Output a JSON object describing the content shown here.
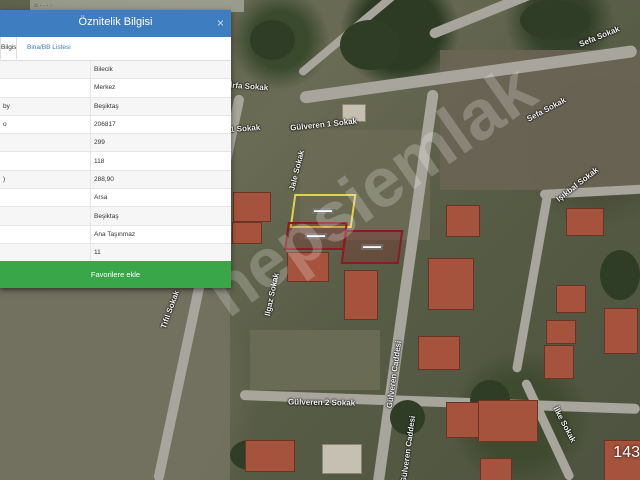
{
  "panel": {
    "title": "Öznitelik Bilgisi",
    "close_glyph": "×",
    "tabs": [
      {
        "label": "Bilgisi",
        "active": true
      },
      {
        "label": "Bina/BB Listesi",
        "active": false
      }
    ],
    "rows": [
      {
        "key": "",
        "value": "Bilecik"
      },
      {
        "key": "",
        "value": "Merkez"
      },
      {
        "key": "by",
        "value": "Beşiktaş"
      },
      {
        "key": "o",
        "value": "206817"
      },
      {
        "key": "",
        "value": "299"
      },
      {
        "key": "",
        "value": "118"
      },
      {
        "key": ")",
        "value": "288,90"
      },
      {
        "key": "",
        "value": "Arsa"
      },
      {
        "key": "",
        "value": "Beşiktaş"
      },
      {
        "key": "",
        "value": "Ana Taşınmaz"
      },
      {
        "key": "",
        "value": "11"
      }
    ],
    "favorite_button": "Favorilere ekle"
  },
  "map": {
    "street_labels": {
      "s1": "Sefa Sokak",
      "s2": "Sefa Sokak",
      "s3": "İrfa Sokak",
      "s4": "Gülveren 1 Sokak",
      "s5": "1 Sokak",
      "s6": "Işıkbal Sokak",
      "s7": "Jale Sokak",
      "s8": "Ilgaz Sokak",
      "s9": "Tıfıl Sokak",
      "s10": "Gülveren 2 Sokak",
      "s11": "Gülveren Caddesi",
      "s12": "Gülveren Caddesi",
      "s13": "İlke Sokak"
    },
    "watermark": "hepsiemlak",
    "corner_number": "143",
    "highlight_color": "#e0d24a",
    "parcel_color": "#8b1a22"
  }
}
